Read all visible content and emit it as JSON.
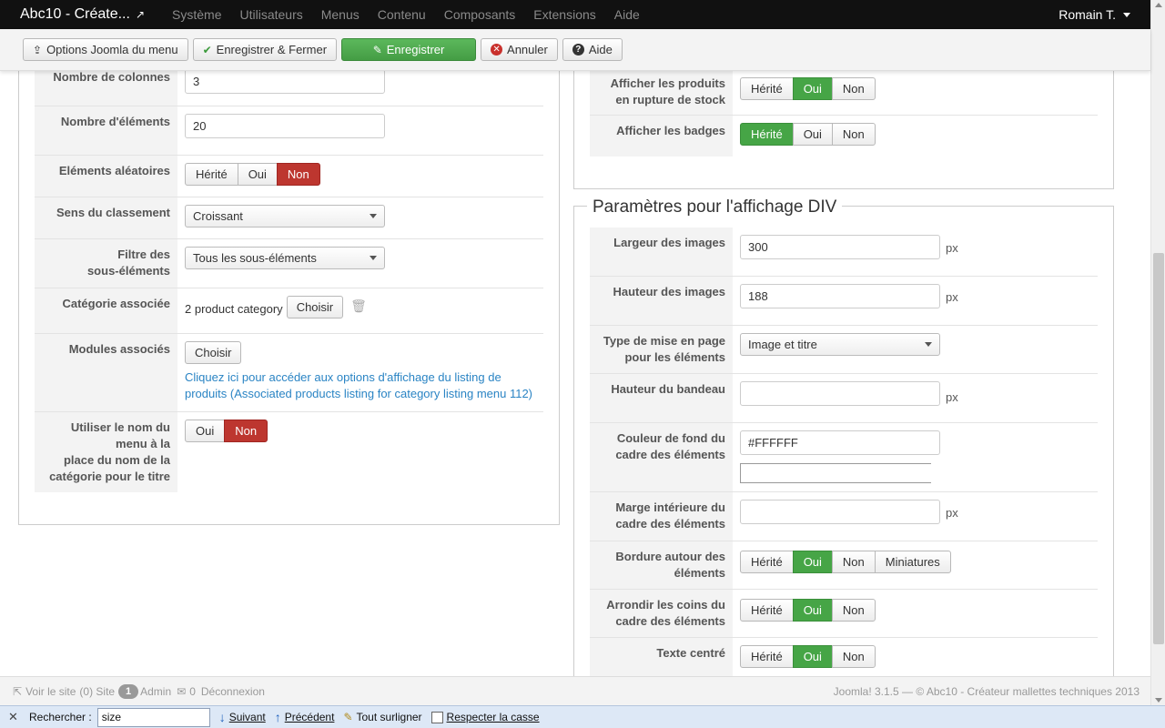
{
  "topnav": {
    "brand": "Abc10 - Créate...",
    "menu": [
      "Système",
      "Utilisateurs",
      "Menus",
      "Contenu",
      "Composants",
      "Extensions",
      "Aide"
    ],
    "user": "Romain T."
  },
  "toolbar": {
    "options": "Options Joomla du menu",
    "save_close": "Enregistrer & Fermer",
    "save": "Enregistrer",
    "cancel": "Annuler",
    "help": "Aide"
  },
  "left": {
    "nb_colonnes": {
      "label": "Nombre de colonnes",
      "value": "3"
    },
    "nb_elements": {
      "label": "Nombre d'éléments",
      "value": "20"
    },
    "aleatoires": {
      "label": "Eléments aléatoires",
      "options": [
        "Hérité",
        "Oui",
        "Non"
      ],
      "selected": "Non"
    },
    "sens": {
      "label": "Sens du classement",
      "value": "Croissant"
    },
    "filtre": {
      "label1": "Filtre des",
      "label2": "sous-éléments",
      "value": "Tous les sous-éléments"
    },
    "categorie": {
      "label": "Catégorie associée",
      "value": "2 product category",
      "button": "Choisir"
    },
    "modules": {
      "label": "Modules associés",
      "button": "Choisir",
      "link1": "Cliquez ici pour accéder aux options d'affichage du listing de",
      "link2": "produits (Associated products listing for category listing menu 112)"
    },
    "utiliser": {
      "label1": "Utiliser le nom du",
      "label2": "menu à la",
      "label3": "place du nom de la",
      "label4": "catégorie pour le titre",
      "options": [
        "Oui",
        "Non"
      ],
      "selected": "Non"
    }
  },
  "right_top": {
    "rupture": {
      "label1": "Afficher les produits",
      "label2": "en rupture de stock",
      "options": [
        "Hérité",
        "Oui",
        "Non"
      ],
      "selected": "Oui"
    },
    "badges": {
      "label": "Afficher les badges",
      "options": [
        "Hérité",
        "Oui",
        "Non"
      ],
      "selected": "Hérité"
    }
  },
  "div_params": {
    "legend": "Paramètres pour l'affichage DIV",
    "largeur": {
      "label": "Largeur des images",
      "value": "300",
      "unit": "px"
    },
    "hauteur": {
      "label": "Hauteur des images",
      "value": "188",
      "unit": "px"
    },
    "type": {
      "label1": "Type de mise en page",
      "label2": "pour les éléments",
      "value": "Image et titre"
    },
    "bandeau": {
      "label": "Hauteur du bandeau",
      "value": "",
      "unit": "px"
    },
    "couleur": {
      "label1": "Couleur de fond du",
      "label2": "cadre des éléments",
      "value": "#FFFFFF"
    },
    "marge": {
      "label1": "Marge intérieure du",
      "label2": "cadre des éléments",
      "value": "",
      "unit": "px"
    },
    "bordure": {
      "label1": "Bordure autour des",
      "label2": "éléments",
      "options": [
        "Hérité",
        "Oui",
        "Non",
        "Miniatures"
      ],
      "selected": "Oui"
    },
    "arrondir": {
      "label1": "Arrondir les coins du",
      "label2": "cadre des éléments",
      "options": [
        "Hérité",
        "Oui",
        "Non"
      ],
      "selected": "Oui"
    },
    "centre": {
      "label": "Texte centré",
      "options": [
        "Hérité",
        "Oui",
        "Non"
      ],
      "selected": "Oui"
    }
  },
  "status": {
    "site": "Voir le site",
    "visitors": "(0) Site",
    "admin_count": "1",
    "admin": "Admin",
    "messages": "0",
    "logout": "Déconnexion",
    "footer": "Joomla! 3.1.5  —  © Abc10 - Créateur mallettes techniques 2013"
  },
  "findbar": {
    "label": "Rechercher :",
    "value": "size",
    "next": "Suivant",
    "prev": "Précédent",
    "highlight": "Tout surligner",
    "case": "Respecter la casse"
  },
  "colors": {
    "green": "#46a546",
    "red": "#bd362f",
    "link": "#2a84c4",
    "nav": "#111111"
  }
}
